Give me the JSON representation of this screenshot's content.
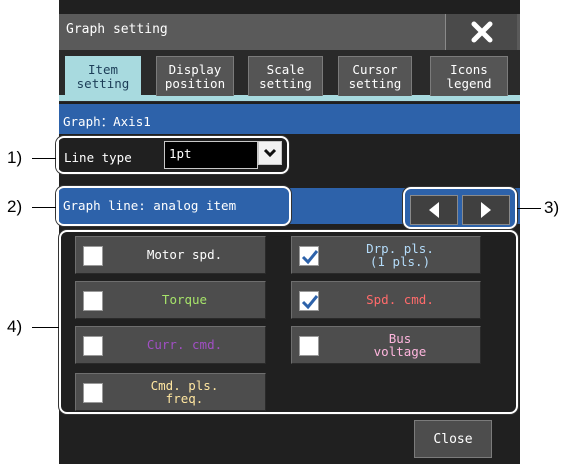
{
  "dialog": {
    "title": "Graph setting",
    "close_icon": "close-x-icon"
  },
  "tabs": [
    {
      "label": "Item\nsetting",
      "active": true
    },
    {
      "label": "Display\nposition",
      "active": false
    },
    {
      "label": "Scale\nsetting",
      "active": false
    },
    {
      "label": "Cursor\nsetting",
      "active": false
    },
    {
      "label": "Icons\nlegend",
      "active": false
    }
  ],
  "graph": {
    "label": "Graph：Axis1"
  },
  "line_type": {
    "label": "Line type",
    "value": "1pt"
  },
  "graph_line": {
    "label": "Graph line: analog item"
  },
  "nav": {
    "prev_icon": "triangle-left-icon",
    "next_icon": "triangle-right-icon"
  },
  "items": [
    {
      "label": "Motor spd.",
      "checked": false,
      "color": "#ffffff"
    },
    {
      "label": "Drp. pls.\n(1 pls.)",
      "checked": true,
      "color": "#b4dcfa"
    },
    {
      "label": "Torque",
      "checked": false,
      "color": "#a6e36a"
    },
    {
      "label": "Spd. cmd.",
      "checked": true,
      "color": "#ff6b6b"
    },
    {
      "label": "Curr. cmd.",
      "checked": false,
      "color": "#a14fc4"
    },
    {
      "label": "Bus\nvoltage",
      "checked": false,
      "color": "#ffb6de"
    },
    {
      "label": "Cmd. pls.\nfreq.",
      "checked": false,
      "color": "#ffe6a0"
    }
  ],
  "footer": {
    "close_label": "Close"
  },
  "callouts": [
    "1)",
    "2)",
    "3)",
    "4)"
  ],
  "colors": {
    "panel": "#202020",
    "accent_tab": "#a8dadf",
    "header_blue": "#2d62aa"
  }
}
